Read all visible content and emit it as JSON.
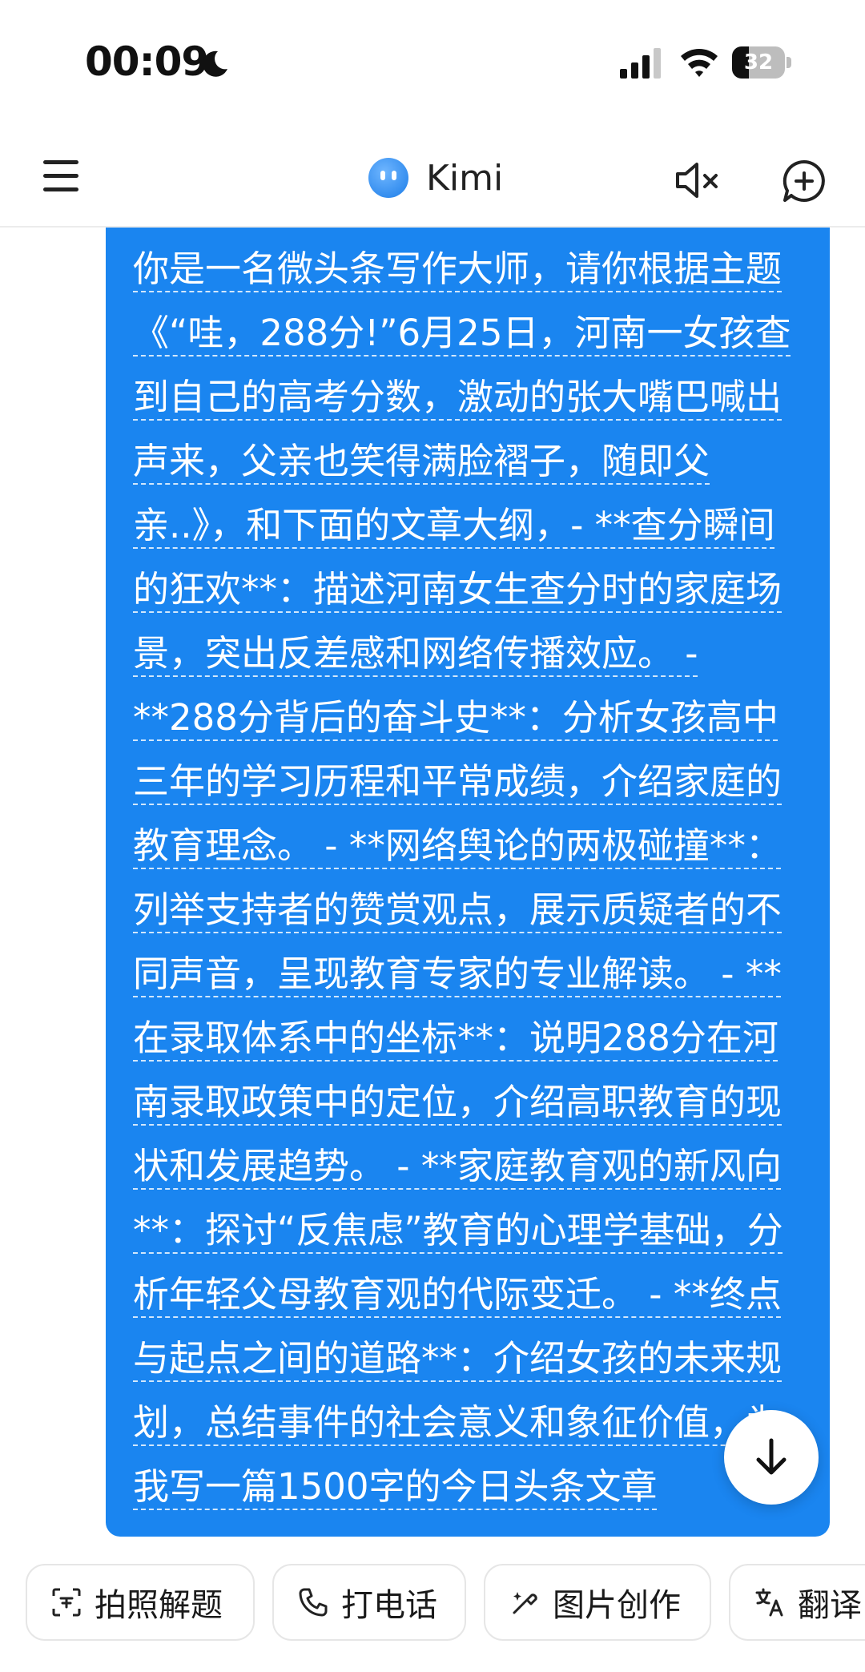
{
  "status_bar": {
    "time": "00:09",
    "battery_level": "32",
    "battery_fraction": 0.32
  },
  "header": {
    "title": "Kimi"
  },
  "message": {
    "text": "你是一名微头条写作大师，请你根据主题《“哇，288分!”6月25日，河南一女孩查到自己的高考分数，激动的张大嘴巴喊出声来，父亲也笑得满脸褶子，随即父亲..》，和下面的文章大纲，- **查分瞬间的狂欢**：描述河南女生查分时的家庭场景，突出反差感和网络传播效应。 - **288分背后的奋斗史**：分析女孩高中三年的学习历程和平常成绩，介绍家庭的教育理念。 - **网络舆论的两极碰撞**：列举支持者的赞赏观点，展示质疑者的不同声音，呈现教育专家的专业解读。 - **在录取体系中的坐标**：说明288分在河南录取政策中的定位，介绍高职教育的现状和发展趋势。 - **家庭教育观的新风向**：探讨“反焦虑”教育的心理学基础，分析年轻父母教育观的代际变迁。 - **终点与起点之间的道路**：介绍女孩的未来规划，总结事件的社会意义和象征价值，为我写一篇1500字的今日头条文章"
  },
  "quick_actions": [
    {
      "label": "拍照解题",
      "icon": "photo-solve-icon"
    },
    {
      "label": "打电话",
      "icon": "phone-icon"
    },
    {
      "label": "图片创作",
      "icon": "image-create-icon"
    },
    {
      "label": "翻译",
      "icon": "translate-icon"
    }
  ],
  "colors": {
    "bubble": "#1a85f0",
    "logo": "#1c7de8"
  }
}
